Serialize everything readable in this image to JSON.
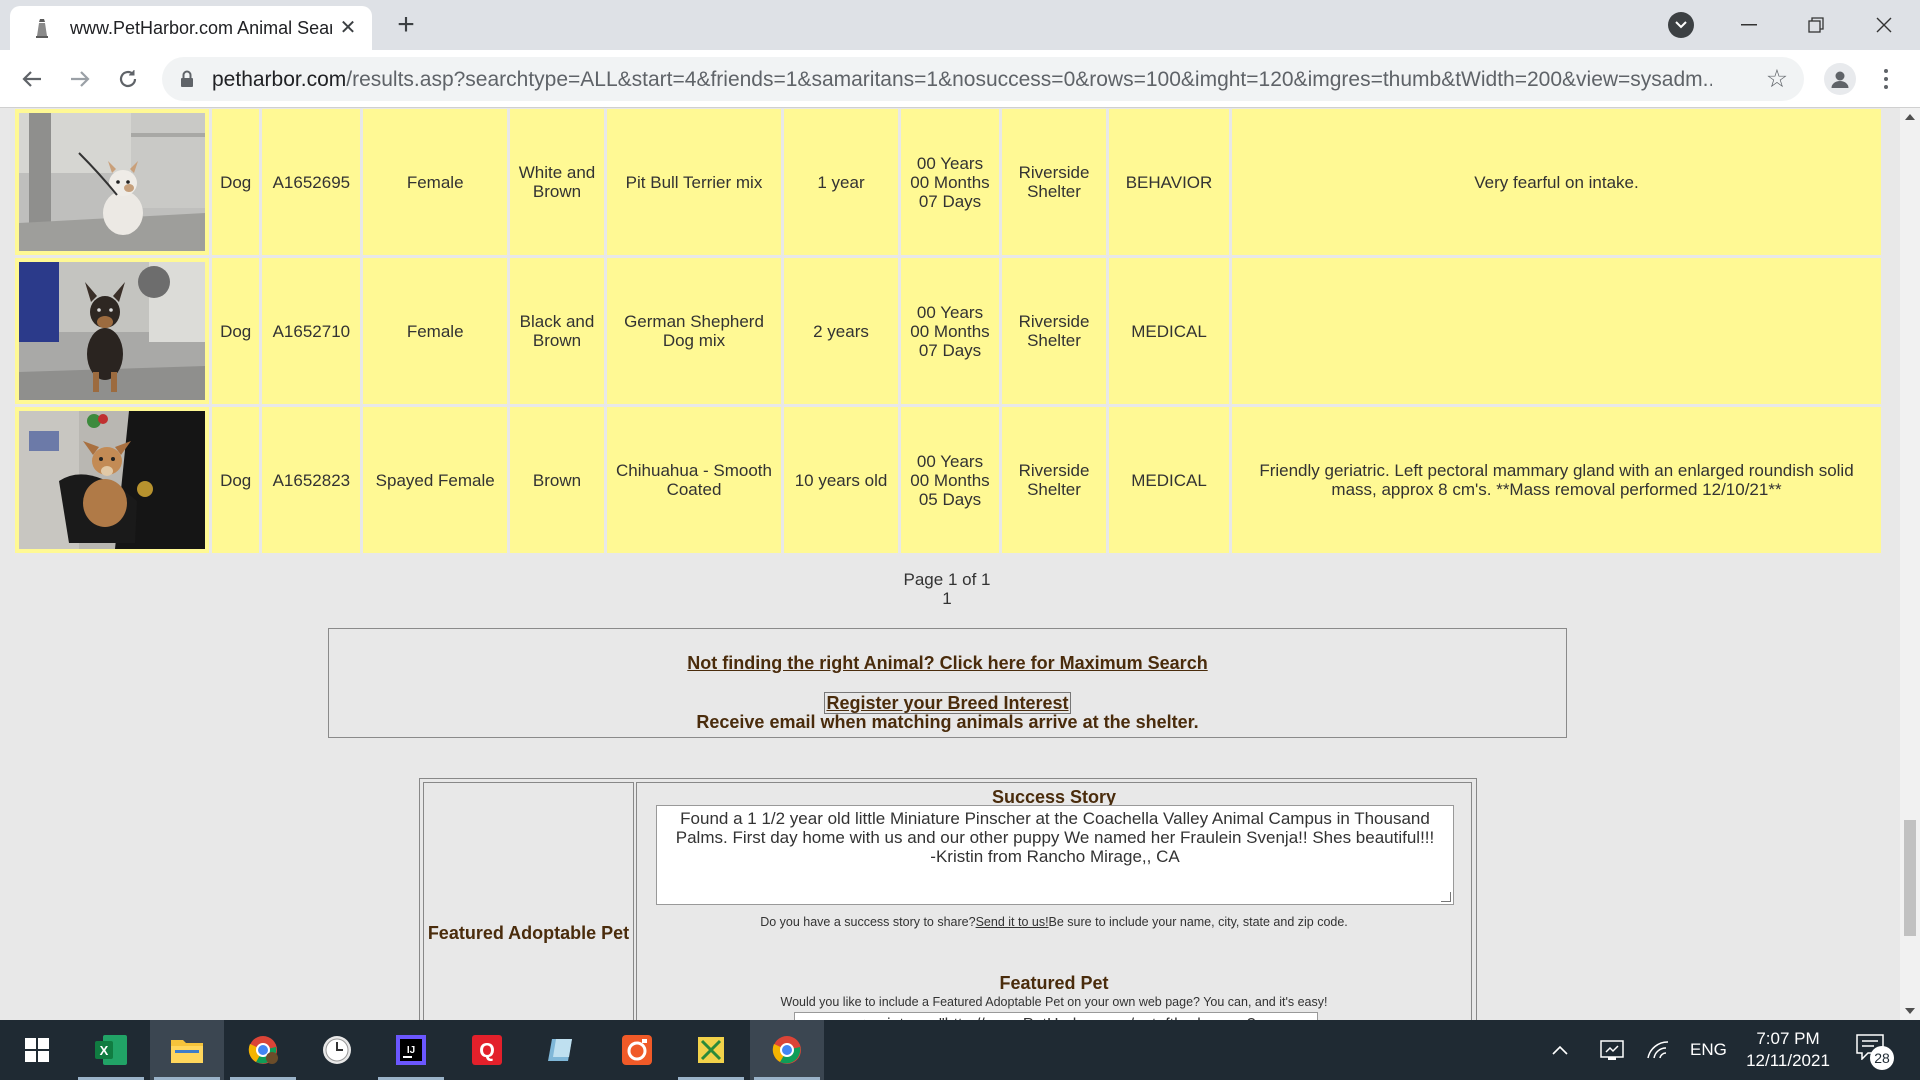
{
  "browser": {
    "tab_title": "www.PetHarbor.com Animal Sear",
    "url_host": "petharbor.com",
    "url_path": "/results.asp?searchtype=ALL&start=4&friends=1&samaritans=1&nosuccess=0&rows=100&imght=120&imgres=thumb&tWidth=200&view=sysadm..."
  },
  "results": [
    {
      "type": "Dog",
      "id": "A1652695",
      "sex": "Female",
      "color": "White and Brown",
      "breed": "Pit Bull Terrier mix",
      "age": "1 year",
      "time_line1": "00 Years",
      "time_line2": "00 Months",
      "time_line3": "07 Days",
      "location": "Riverside Shelter",
      "status": "BEHAVIOR",
      "notes": "Very fearful on intake."
    },
    {
      "type": "Dog",
      "id": "A1652710",
      "sex": "Female",
      "color": "Black and Brown",
      "breed": "German Shepherd Dog mix",
      "age": "2 years",
      "time_line1": "00 Years",
      "time_line2": "00 Months",
      "time_line3": "07 Days",
      "location": "Riverside Shelter",
      "status": "MEDICAL",
      "notes": ""
    },
    {
      "type": "Dog",
      "id": "A1652823",
      "sex": "Spayed Female",
      "color": "Brown",
      "breed": "Chihuahua - Smooth Coated",
      "age": "10 years old",
      "time_line1": "00 Years",
      "time_line2": "00 Months",
      "time_line3": "05 Days",
      "location": "Riverside Shelter",
      "status": "MEDICAL",
      "notes": "Friendly geriatric. Left pectoral mammary gland with an enlarged roundish solid mass, approx 8 cm's. **Mass removal performed 12/10/21**"
    }
  ],
  "pager": {
    "label": "Page 1 of 1",
    "current": "1"
  },
  "maxsearch": {
    "link": "Not finding the right Animal? Click here for Maximum Search",
    "register": "Register your Breed Interest",
    "desc": "Receive email when matching animals arrive at the shelter."
  },
  "featured": {
    "left_label": "Featured Adoptable Pet",
    "success_title": "Success Story",
    "success_text": "Found a 1 1/2 year old little Miniature Pinscher at the Coachella Valley Animal Campus in Thousand Palms.  First day home with us and our other puppy  We named her Fraulein Svenja!!  Shes beautiful!!!",
    "success_sign": "-Kristin from Rancho Mirage,, CA",
    "share_pre": "Do you have a success story to share?",
    "share_link": "Send it to us!",
    "share_post": "Be sure to include your name, city, state and zip code.",
    "pet_title": "Featured Pet",
    "pet_desc": "Would you like to include a Featured Adoptable Pet on your own web page? You can, and it's easy!",
    "pet_code": "<script src=\"http://www.PetHarbor.com/petoftheday.asp?"
  },
  "taskbar": {
    "lang": "ENG",
    "time": "7:07 PM",
    "date": "12/11/2021",
    "notifications": "28"
  },
  "colors": {
    "row_bg": "#fff994",
    "page_bg": "#e8e8e8",
    "heading": "#4a2c0c",
    "taskbar": "#1f2a33"
  }
}
